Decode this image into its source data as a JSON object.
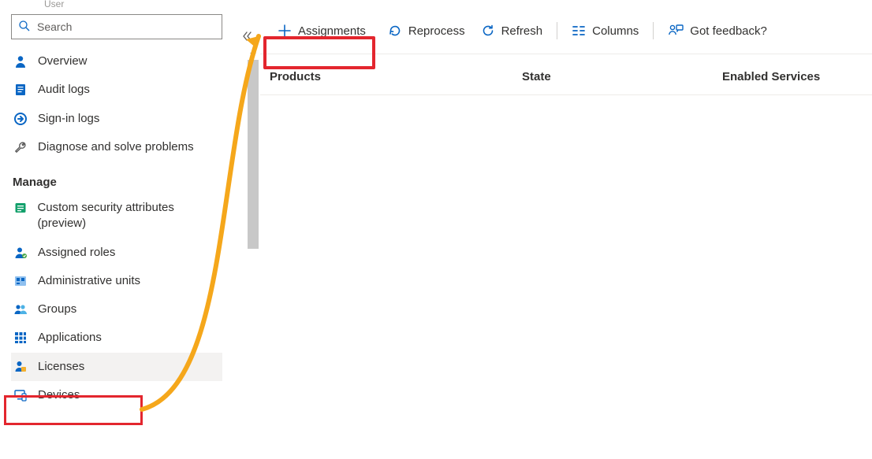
{
  "breadcrumb": "User",
  "search": {
    "placeholder": "Search"
  },
  "sidebar": {
    "top": [
      {
        "label": "Overview",
        "iconName": "overview-icon"
      },
      {
        "label": "Audit logs",
        "iconName": "audit-logs-icon"
      },
      {
        "label": "Sign-in logs",
        "iconName": "signin-logs-icon"
      },
      {
        "label": "Diagnose and solve problems",
        "iconName": "diagnose-icon"
      }
    ],
    "manageHeader": "Manage",
    "manage": [
      {
        "label": "Custom security attributes (preview)",
        "iconName": "security-attr-icon"
      },
      {
        "label": "Assigned roles",
        "iconName": "assigned-roles-icon"
      },
      {
        "label": "Administrative units",
        "iconName": "admin-units-icon"
      },
      {
        "label": "Groups",
        "iconName": "groups-icon"
      },
      {
        "label": "Applications",
        "iconName": "applications-icon"
      },
      {
        "label": "Licenses",
        "iconName": "licenses-icon",
        "selected": true
      },
      {
        "label": "Devices",
        "iconName": "devices-icon"
      }
    ]
  },
  "toolbar": {
    "assignments": "Assignments",
    "reprocess": "Reprocess",
    "refresh": "Refresh",
    "columns": "Columns",
    "feedback": "Got feedback?"
  },
  "table": {
    "colProducts": "Products",
    "colState": "State",
    "colServices": "Enabled Services"
  }
}
